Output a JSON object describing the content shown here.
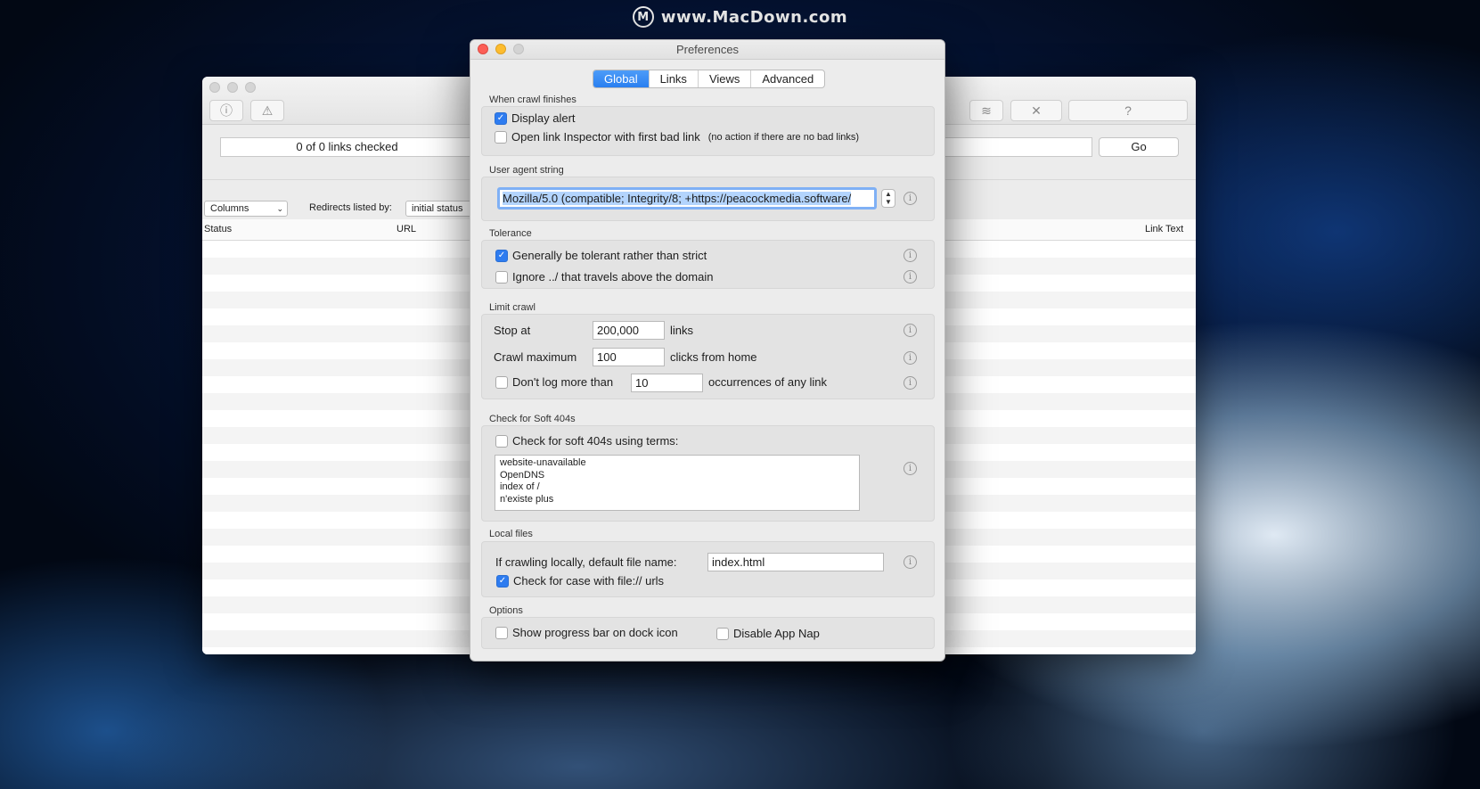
{
  "watermark": {
    "logo": "M",
    "text": "www.MacDown.com"
  },
  "bg_window": {
    "links_checked": "0 of 0 links checked",
    "go_label": "Go",
    "columns_select": "Columns",
    "redirects_label": "Redirects listed by:",
    "redirects_value": "initial status",
    "col_status": "Status",
    "col_url": "URL",
    "col_link_text": "Link Text",
    "toolbar_help": "?"
  },
  "prefs": {
    "title": "Preferences",
    "tabs": [
      "Global",
      "Links",
      "Views",
      "Advanced"
    ],
    "active_tab": "Global",
    "when_crawl_finishes": {
      "label": "When crawl finishes",
      "display_alert": "Display alert",
      "display_alert_checked": true,
      "open_inspector": "Open link Inspector with first bad link",
      "open_inspector_checked": false,
      "open_inspector_note": "(no action if there are no bad links)"
    },
    "user_agent": {
      "label": "User agent string",
      "value": "Mozilla/5.0 (compatible; Integrity/8; +https://peacockmedia.software/"
    },
    "tolerance": {
      "label": "Tolerance",
      "tolerant": "Generally be tolerant rather than strict",
      "tolerant_checked": true,
      "ignore_dotdot": "Ignore ../ that travels above the domain",
      "ignore_dotdot_checked": false
    },
    "limit_crawl": {
      "label": "Limit crawl",
      "stop_at": "Stop at",
      "stop_at_value": "200,000",
      "stop_at_unit": "links",
      "crawl_max": "Crawl maximum",
      "crawl_max_value": "100",
      "crawl_max_unit": "clicks from home",
      "dont_log": "Don't log more than",
      "dont_log_checked": false,
      "dont_log_value": "10",
      "dont_log_unit": "occurrences of any link"
    },
    "soft404": {
      "label": "Check for Soft 404s",
      "check": "Check for soft 404s using terms:",
      "check_checked": false,
      "terms": [
        "website-unavailable",
        "OpenDNS",
        "index of /",
        "n'existe plus"
      ]
    },
    "local_files": {
      "label": "Local files",
      "default_name_label": "If crawling locally, default file name:",
      "default_name_value": "index.html",
      "case_check": "Check for case with file:// urls",
      "case_check_checked": true
    },
    "options": {
      "label": "Options",
      "progress_bar": "Show progress bar on dock icon",
      "progress_bar_checked": false,
      "app_nap": "Disable App Nap",
      "app_nap_checked": false
    },
    "info_glyph": "i",
    "check_glyph": "✓",
    "stepper_glyph_up": "▲",
    "stepper_glyph_down": "▼"
  }
}
